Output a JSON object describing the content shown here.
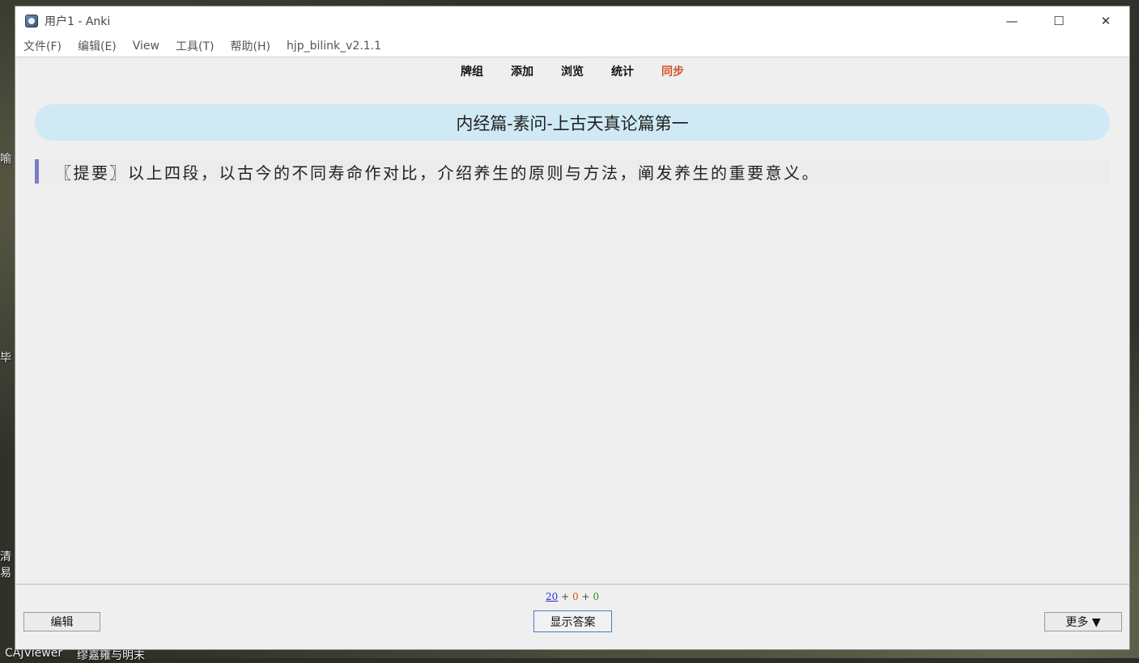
{
  "window": {
    "title": "用户1 - Anki",
    "controls": {
      "minimize": "—",
      "maximize": "☐",
      "close": "✕"
    }
  },
  "menu": [
    "文件(F)",
    "编辑(E)",
    "View",
    "工具(T)",
    "帮助(H)",
    "hjp_bilink_v2.1.1"
  ],
  "toolbar": {
    "decks": "牌组",
    "add": "添加",
    "browse": "浏览",
    "stats": "统计",
    "sync": "同步",
    "sync_color": "#d0542e"
  },
  "card": {
    "deck_title": "内经篇-素问-上古天真论篇第一",
    "text": "〖提要〗以上四段，以古今的不同寿命作对比，介绍养生的原则与方法，阐发养生的重要意义。",
    "banner_color": "#cfeaf4",
    "accent_color": "#7c7cc4"
  },
  "bottom": {
    "counts": {
      "new": "20",
      "sep1": " + ",
      "learn": "0",
      "sep2": " + ",
      "review": "0"
    },
    "edit_label": "编辑",
    "show_answer_label": "显示答案",
    "more_label": "更多 ▼"
  },
  "desktop": {
    "labels": [
      "喻",
      "毕",
      "清",
      "易",
      "CAJViewer",
      "缪嘉雍与明末"
    ]
  }
}
